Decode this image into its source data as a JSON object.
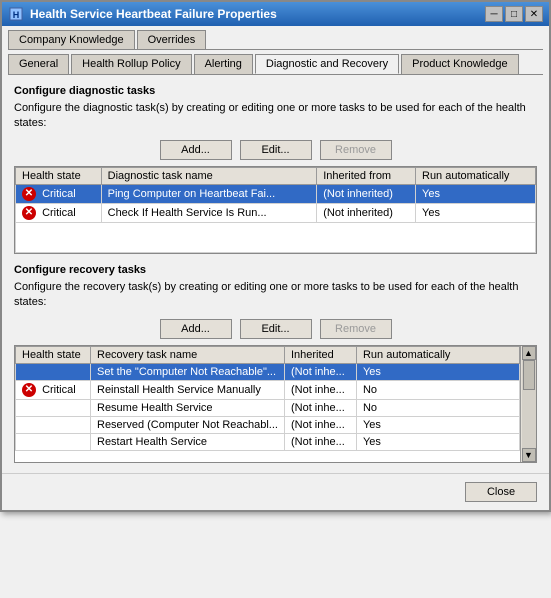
{
  "window": {
    "title": "Health Service Heartbeat Failure Properties",
    "close_label": "✕",
    "minimize_label": "─",
    "maximize_label": "□"
  },
  "tabs_row1": [
    {
      "id": "company-knowledge",
      "label": "Company Knowledge",
      "active": false
    },
    {
      "id": "overrides",
      "label": "Overrides",
      "active": false
    }
  ],
  "tabs_row2": [
    {
      "id": "general",
      "label": "General",
      "active": false
    },
    {
      "id": "health-rollup",
      "label": "Health Rollup Policy",
      "active": false
    },
    {
      "id": "alerting",
      "label": "Alerting",
      "active": false
    },
    {
      "id": "diagnostic-recovery",
      "label": "Diagnostic and Recovery",
      "active": true
    },
    {
      "id": "product-knowledge",
      "label": "Product Knowledge",
      "active": false
    }
  ],
  "diagnostic_section": {
    "title": "Configure diagnostic tasks",
    "description": "Configure the diagnostic task(s) by creating or editing one or more tasks to be used for each of the health states:",
    "add_label": "Add...",
    "edit_label": "Edit...",
    "remove_label": "Remove",
    "columns": [
      "Health state",
      "Diagnostic task name",
      "Inherited from",
      "Run automatically"
    ],
    "rows": [
      {
        "state": "Critical",
        "task": "Ping Computer on Heartbeat Fai...",
        "inherited": "(Not inherited)",
        "auto": "Yes",
        "selected": true
      },
      {
        "state": "Critical",
        "task": "Check If Health Service Is Run...",
        "inherited": "(Not inherited)",
        "auto": "Yes",
        "selected": false
      }
    ]
  },
  "recovery_section": {
    "title": "Configure recovery tasks",
    "description": "Configure the recovery task(s) by creating or editing one or more tasks to be used for each of the health states:",
    "add_label": "Add...",
    "edit_label": "Edit...",
    "remove_label": "Remove",
    "columns": [
      "Health state",
      "Recovery task name",
      "Inherited",
      "Run automatically"
    ],
    "rows": [
      {
        "state": "",
        "task": "Set the \"Computer Not Reachable\"...",
        "inherited": "(Not inhe...",
        "auto": "Yes",
        "selected": true
      },
      {
        "state": "Critical",
        "task": "Reinstall Health Service Manually",
        "inherited": "(Not inhe...",
        "auto": "No",
        "selected": false
      },
      {
        "state": "",
        "task": "Resume Health Service",
        "inherited": "(Not inhe...",
        "auto": "No",
        "selected": false
      },
      {
        "state": "",
        "task": "Reserved (Computer Not Reachabl...",
        "inherited": "(Not inhe...",
        "auto": "Yes",
        "selected": false
      },
      {
        "state": "",
        "task": "Restart Health Service",
        "inherited": "(Not inhe...",
        "auto": "Yes",
        "selected": false
      }
    ]
  },
  "footer": {
    "close_label": "Close"
  }
}
